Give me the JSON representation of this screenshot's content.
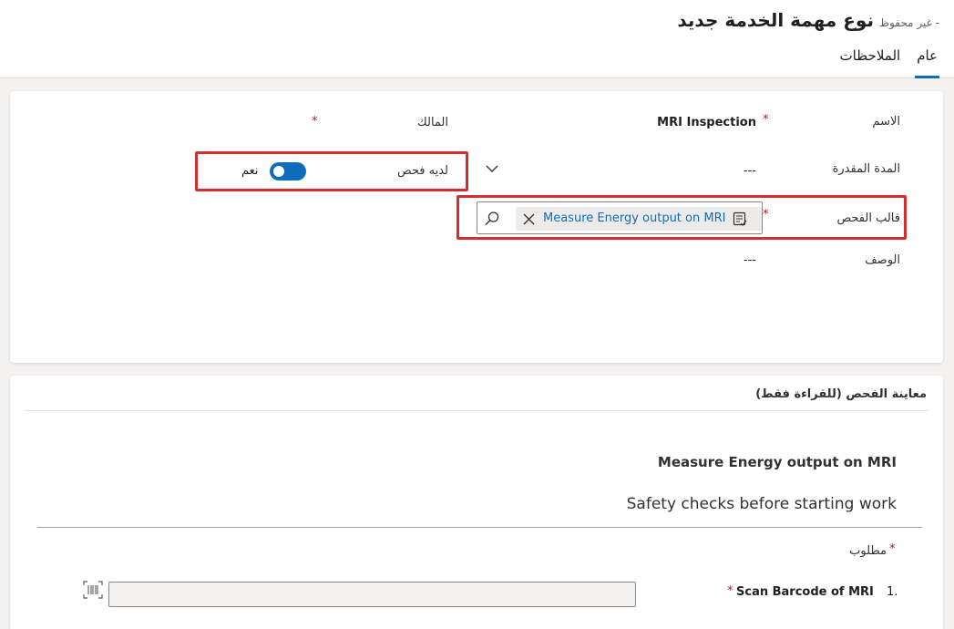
{
  "header": {
    "title": "نوع مهمة الخدمة جديد",
    "subtitle": "- غير محفوظ",
    "tabs": [
      {
        "label": "عام",
        "active": true
      },
      {
        "label": "الملاحظات",
        "active": false
      }
    ]
  },
  "general": {
    "name_label": "الاسم",
    "name_value": "MRI Inspection",
    "owner_label": "المالك",
    "duration_label": "المدة المقدرة",
    "duration_value": "---",
    "has_inspection_label": "لديه فحص",
    "has_inspection_value": "نعم",
    "has_inspection_on": true,
    "template_label": "قالب الفحص",
    "template_value": "Measure Energy output on MRI",
    "description_label": "الوصف",
    "description_value": "---",
    "required_marker": "*"
  },
  "preview": {
    "section_title": "معاينة الفحص (للقراءة فقط)",
    "title": "Measure Energy output on MRI",
    "subtitle": "Safety checks before starting work",
    "required_note": "مطلوب",
    "question_number": "1.",
    "question_label": "Scan Barcode of MRI"
  },
  "colors": {
    "accent": "#0f6cbd",
    "highlight_border": "#d32f2f",
    "required": "#c50f1f"
  }
}
